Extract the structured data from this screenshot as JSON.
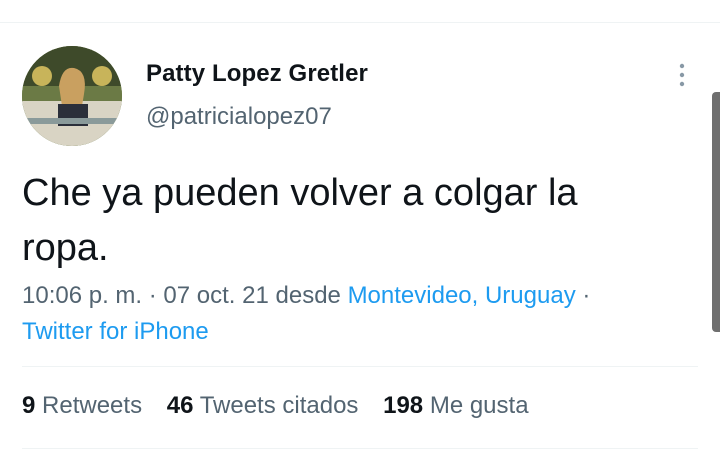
{
  "author": {
    "name": "Patty Lopez Gretler",
    "handle": "@patricialopez07"
  },
  "tweet": {
    "text_line1": "Che ya pueden volver a colgar la",
    "text_line2": "ropa."
  },
  "meta": {
    "time": "10:06 p. m.",
    "sep1": " · ",
    "date": "07 oct. 21",
    "from": " desde ",
    "location": "Montevideo, Uruguay",
    "sep2": " ·",
    "source": "Twitter for iPhone"
  },
  "stats": {
    "retweets_count": "9",
    "retweets_label": " Retweets",
    "quotes_count": "46",
    "quotes_label": " Tweets citados",
    "likes_count": "198",
    "likes_label": " Me gusta"
  },
  "icons": {
    "more": "more-vertical-icon"
  },
  "colors": {
    "link": "#1d9bf0",
    "secondary_text": "#536471",
    "primary_text": "#0f1419"
  }
}
